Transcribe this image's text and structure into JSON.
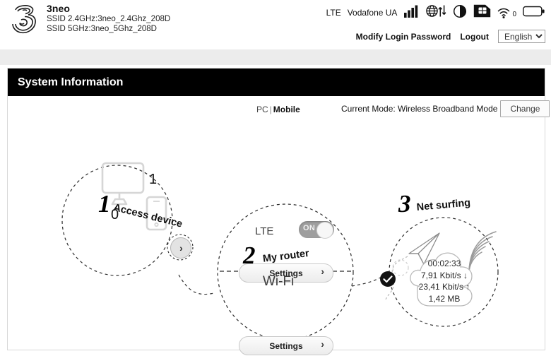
{
  "header": {
    "logo_icon": "three-logo-icon",
    "brand_name": "3neo",
    "ssid_24": "SSID 2.4GHz:3neo_2.4Ghz_208D",
    "ssid_5": "SSID 5GHz:3neo_5Ghz_208D",
    "status": {
      "network_type": "LTE",
      "operator": "Vodafone UA",
      "icons": [
        "signal-bars-icon",
        "globe-data-transfer-icon",
        "contrast-circle-icon",
        "sim-card-icon",
        "wifi-clients-icon",
        "battery-empty-icon"
      ],
      "wifi_client_count": "0"
    },
    "links": {
      "modify_password": "Modify Login Password",
      "logout": "Logout"
    },
    "language": {
      "selected": "English",
      "options": [
        "English"
      ]
    }
  },
  "panel": {
    "title": "System Information",
    "view_toggle": {
      "pc": "PC",
      "separator": "|",
      "mobile": "Mobile"
    },
    "mode": {
      "label": "Current Mode: Wireless Broadband Mode",
      "change_button": "Change"
    }
  },
  "diagram": {
    "step1": {
      "number": "1",
      "label": "Access device",
      "pc_icon": "desktop-monitor-icon",
      "pc_count": "1",
      "mobile_icon": "smartphone-icon",
      "mobile_count": "0",
      "expand_arrow": "›"
    },
    "step2": {
      "number": "2",
      "label": "My router",
      "lte": {
        "label": "LTE",
        "toggle_state": "ON",
        "settings_label": "Settings",
        "settings_chevron": "›"
      },
      "wifi": {
        "label": "Wi-Fi",
        "settings_label": "Settings",
        "settings_chevron": "›"
      }
    },
    "step3": {
      "number": "3",
      "label": "Net surfing",
      "paper_plane_icon": "paper-plane-icon",
      "signal_waves_icon": "signal-waves-icon",
      "cloud_icon": "cloud-icon",
      "stats": [
        "00:02:33",
        "7,91 Kbit/s ↓",
        "23,41 Kbit/s ↑",
        "1,42 MB"
      ]
    },
    "connection_ok_icon": "check-circle-icon"
  },
  "colors": {
    "panel_header_bg": "#000000",
    "page_bg": "#ececec",
    "accent_gray": "#9e9e9e"
  }
}
